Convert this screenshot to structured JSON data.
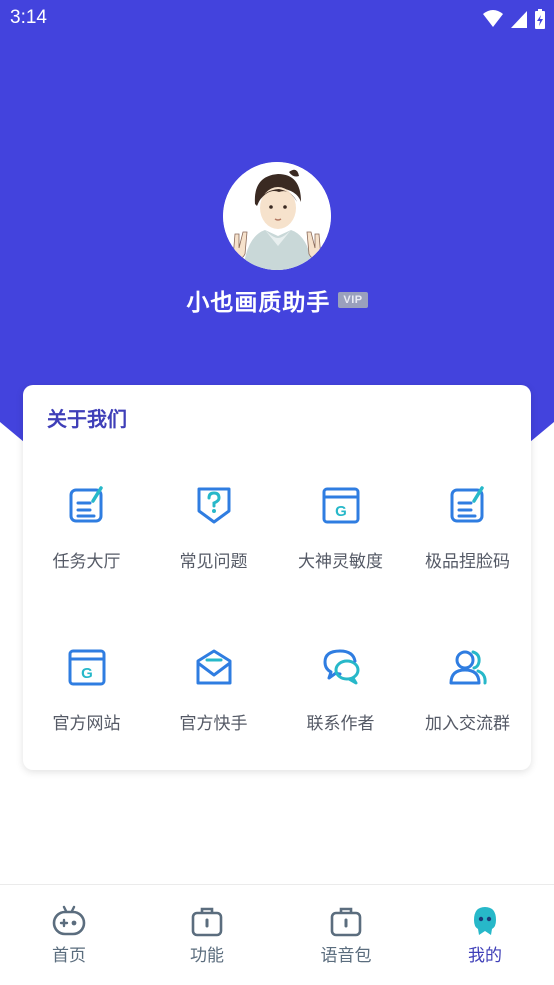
{
  "status_bar": {
    "time": "3:14"
  },
  "profile": {
    "name": "小也画质助手",
    "badge": "VIP"
  },
  "about": {
    "title": "关于我们",
    "items": [
      {
        "label": "任务大厅",
        "icon": "task-icon"
      },
      {
        "label": "常见问题",
        "icon": "question-shield-icon"
      },
      {
        "label": "大神灵敏度",
        "icon": "browser-g-icon"
      },
      {
        "label": "极品捏脸码",
        "icon": "task-icon"
      },
      {
        "label": "官方网站",
        "icon": "browser-g-icon"
      },
      {
        "label": "官方快手",
        "icon": "mail-icon"
      },
      {
        "label": "联系作者",
        "icon": "chat-icon"
      },
      {
        "label": "加入交流群",
        "icon": "group-icon"
      }
    ]
  },
  "bottom_nav": {
    "items": [
      {
        "label": "首页",
        "icon": "gamepad-icon"
      },
      {
        "label": "功能",
        "icon": "toolbox-icon"
      },
      {
        "label": "语音包",
        "icon": "toolbox-icon"
      },
      {
        "label": "我的",
        "icon": "user-blob-icon",
        "active": true
      }
    ]
  },
  "colors": {
    "primary": "#4343dd",
    "accent": "#2f7de1",
    "teal": "#27b8c9",
    "active": "#3f3fb8"
  }
}
